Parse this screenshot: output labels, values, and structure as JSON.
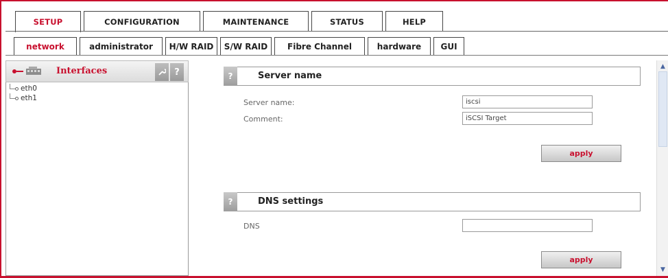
{
  "top_tabs": [
    {
      "label": "SETUP"
    },
    {
      "label": "CONFIGURATION"
    },
    {
      "label": "MAINTENANCE"
    },
    {
      "label": "STATUS"
    },
    {
      "label": "HELP"
    }
  ],
  "sub_tabs": [
    {
      "label": "network"
    },
    {
      "label": "administrator"
    },
    {
      "label": "H/W RAID"
    },
    {
      "label": "S/W RAID"
    },
    {
      "label": "Fibre Channel"
    },
    {
      "label": "hardware"
    },
    {
      "label": "GUI"
    }
  ],
  "left_panel": {
    "title": "Interfaces",
    "wrench_icon": "wrench-icon",
    "help_label": "?",
    "items": [
      {
        "label": "eth0"
      },
      {
        "label": "eth1"
      }
    ]
  },
  "server_name_section": {
    "title": "Server name",
    "help_label": "?",
    "fields": [
      {
        "label": "Server name:",
        "value": "iscsi"
      },
      {
        "label": "Comment:",
        "value": "iSCSI Target"
      }
    ],
    "apply_label": "apply"
  },
  "dns_section": {
    "title": "DNS settings",
    "help_label": "?",
    "fields": [
      {
        "label": "DNS",
        "value": ""
      }
    ],
    "apply_label": "apply"
  },
  "colors": {
    "accent": "#c8102e"
  }
}
